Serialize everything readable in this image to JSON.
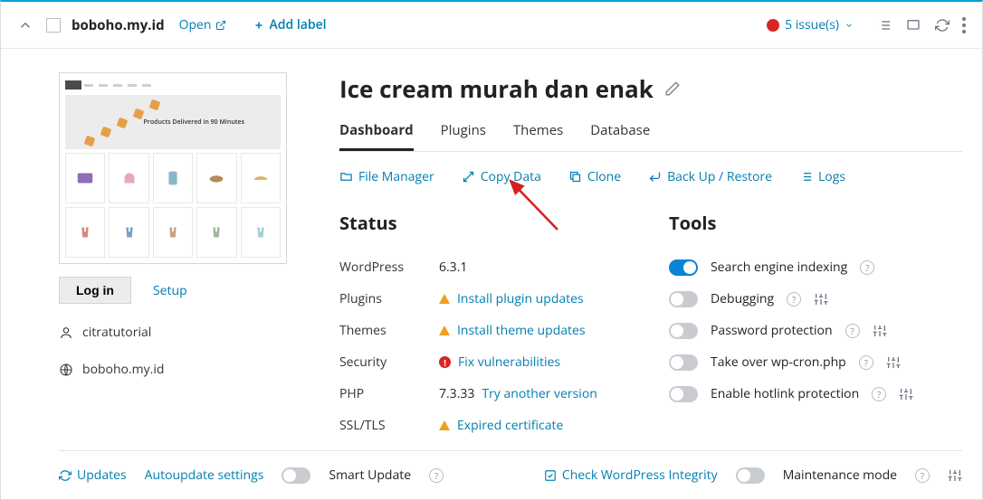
{
  "header": {
    "domain": "boboho.my.id",
    "open": "Open",
    "add_label": "Add label",
    "issues_count": "5 issue(s)"
  },
  "left": {
    "banner_caption": "Products Delivered in 90 Minutes",
    "login_btn": "Log in",
    "setup": "Setup",
    "user": "citratutorial",
    "site_domain": "boboho.my.id"
  },
  "right": {
    "title": "Ice cream murah dan enak",
    "tabs": [
      "Dashboard",
      "Plugins",
      "Themes",
      "Database"
    ],
    "toolbar": {
      "file_manager": "File Manager",
      "copy_data": "Copy Data",
      "clone": "Clone",
      "backup": "Back Up / Restore",
      "logs": "Logs"
    },
    "status": {
      "heading": "Status",
      "wordpress_label": "WordPress",
      "wordpress_value": "6.3.1",
      "plugins_label": "Plugins",
      "plugins_link": "Install plugin updates",
      "themes_label": "Themes",
      "themes_link": "Install theme updates",
      "security_label": "Security",
      "security_link": "Fix vulnerabilities",
      "php_label": "PHP",
      "php_value": "7.3.33",
      "php_link": "Try another version",
      "ssl_label": "SSL/TLS",
      "ssl_link": "Expired certificate"
    },
    "tools": {
      "heading": "Tools",
      "search_indexing": "Search engine indexing",
      "debugging": "Debugging",
      "password": "Password protection",
      "wpcron": "Take over wp-cron.php",
      "hotlink": "Enable hotlink protection"
    }
  },
  "footer": {
    "updates": "Updates",
    "auto": "Autoupdate settings",
    "smart": "Smart Update",
    "check_integrity": "Check WordPress Integrity",
    "maintenance": "Maintenance mode"
  }
}
